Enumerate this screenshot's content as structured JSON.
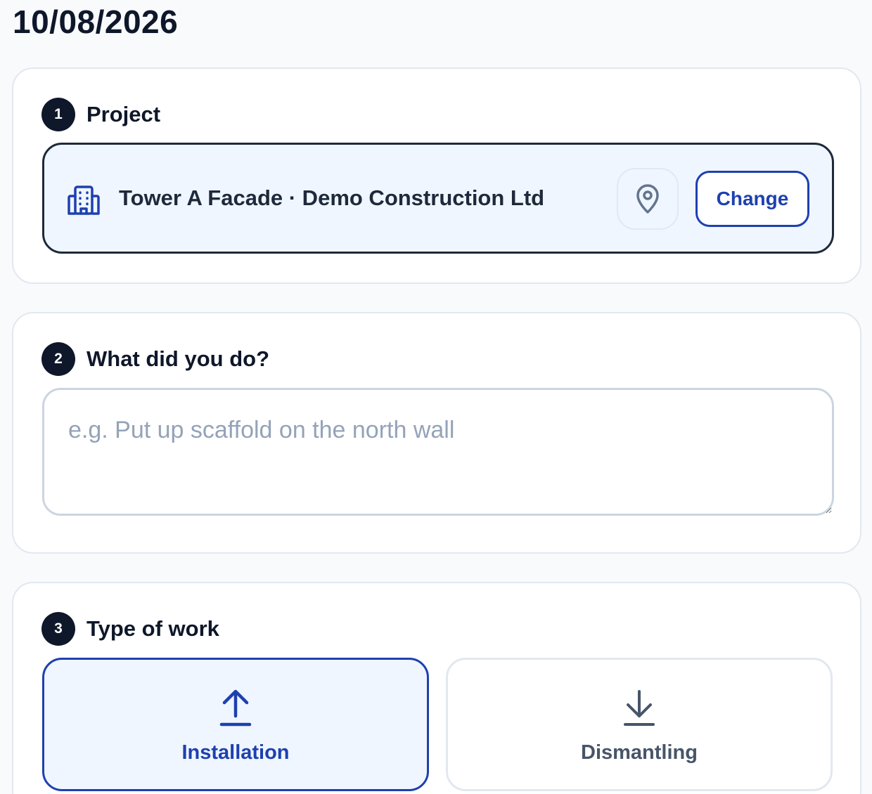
{
  "page": {
    "date": "10/08/2026"
  },
  "sections": {
    "project": {
      "step": "1",
      "title": "Project",
      "name": "Tower A Facade · Demo Construction Ltd",
      "location_icon": "map-pin-icon",
      "building_icon": "building-icon",
      "change_label": "Change"
    },
    "description": {
      "step": "2",
      "title": "What did you do?",
      "value": "",
      "placeholder": "e.g. Put up scaffold on the north wall"
    },
    "work_type": {
      "step": "3",
      "title": "Type of work",
      "selected": "Installation",
      "options": [
        {
          "label": "Installation",
          "icon": "upload-arrow-icon"
        },
        {
          "label": "Dismantling",
          "icon": "download-arrow-icon"
        }
      ]
    }
  },
  "colors": {
    "accent": "#1e40af",
    "dark": "#0f172a",
    "selected_bg": "#eff6ff",
    "border": "#e2e8f0",
    "placeholder": "#94a3b8"
  }
}
